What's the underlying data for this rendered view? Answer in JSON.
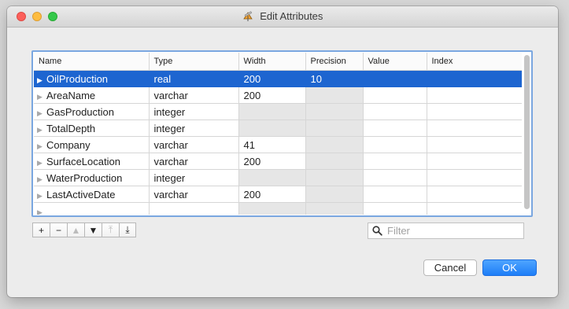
{
  "window": {
    "title": "Edit Attributes",
    "title_icon": "edit-attributes-tool-icon"
  },
  "table": {
    "columns": [
      "Name",
      "Type",
      "Width",
      "Precision",
      "Value",
      "Index"
    ],
    "rows": [
      {
        "name": "OilProduction",
        "type": "real",
        "width": "200",
        "precision": "10",
        "value": "",
        "index": "",
        "selected": true,
        "width_disabled": false,
        "precision_disabled": false
      },
      {
        "name": "AreaName",
        "type": "varchar",
        "width": "200",
        "precision": "",
        "value": "",
        "index": "",
        "selected": false,
        "width_disabled": false,
        "precision_disabled": true
      },
      {
        "name": "GasProduction",
        "type": "integer",
        "width": "",
        "precision": "",
        "value": "",
        "index": "",
        "selected": false,
        "width_disabled": true,
        "precision_disabled": true
      },
      {
        "name": "TotalDepth",
        "type": "integer",
        "width": "",
        "precision": "",
        "value": "",
        "index": "",
        "selected": false,
        "width_disabled": true,
        "precision_disabled": true
      },
      {
        "name": "Company",
        "type": "varchar",
        "width": "41",
        "precision": "",
        "value": "",
        "index": "",
        "selected": false,
        "width_disabled": false,
        "precision_disabled": true
      },
      {
        "name": "SurfaceLocation",
        "type": "varchar",
        "width": "200",
        "precision": "",
        "value": "",
        "index": "",
        "selected": false,
        "width_disabled": false,
        "precision_disabled": true
      },
      {
        "name": "WaterProduction",
        "type": "integer",
        "width": "",
        "precision": "",
        "value": "",
        "index": "",
        "selected": false,
        "width_disabled": true,
        "precision_disabled": true
      },
      {
        "name": "LastActiveDate",
        "type": "varchar",
        "width": "200",
        "precision": "",
        "value": "",
        "index": "",
        "selected": false,
        "width_disabled": false,
        "precision_disabled": true
      },
      {
        "name": "",
        "type": "",
        "width": "",
        "precision": "",
        "value": "",
        "index": "",
        "selected": false,
        "width_disabled": true,
        "precision_disabled": true
      }
    ],
    "colors": {
      "selection": "#1d65d0",
      "focus_ring": "#7aa7e0"
    }
  },
  "toolbar": {
    "buttons": [
      {
        "name": "add-row-button",
        "label": "+",
        "enabled": true
      },
      {
        "name": "remove-row-button",
        "label": "−",
        "enabled": true
      },
      {
        "name": "move-up-button",
        "label": "▲",
        "enabled": false
      },
      {
        "name": "move-down-button",
        "label": "▼",
        "enabled": true
      },
      {
        "name": "move-to-top-button",
        "label": "⤒",
        "enabled": false
      },
      {
        "name": "move-to-bottom-button",
        "label": "⤓",
        "enabled": true
      }
    ]
  },
  "filter": {
    "placeholder": "Filter",
    "value": "",
    "icon": "search-icon"
  },
  "actions": {
    "cancel_label": "Cancel",
    "ok_label": "OK",
    "ok_color": "#1e7ef7"
  }
}
